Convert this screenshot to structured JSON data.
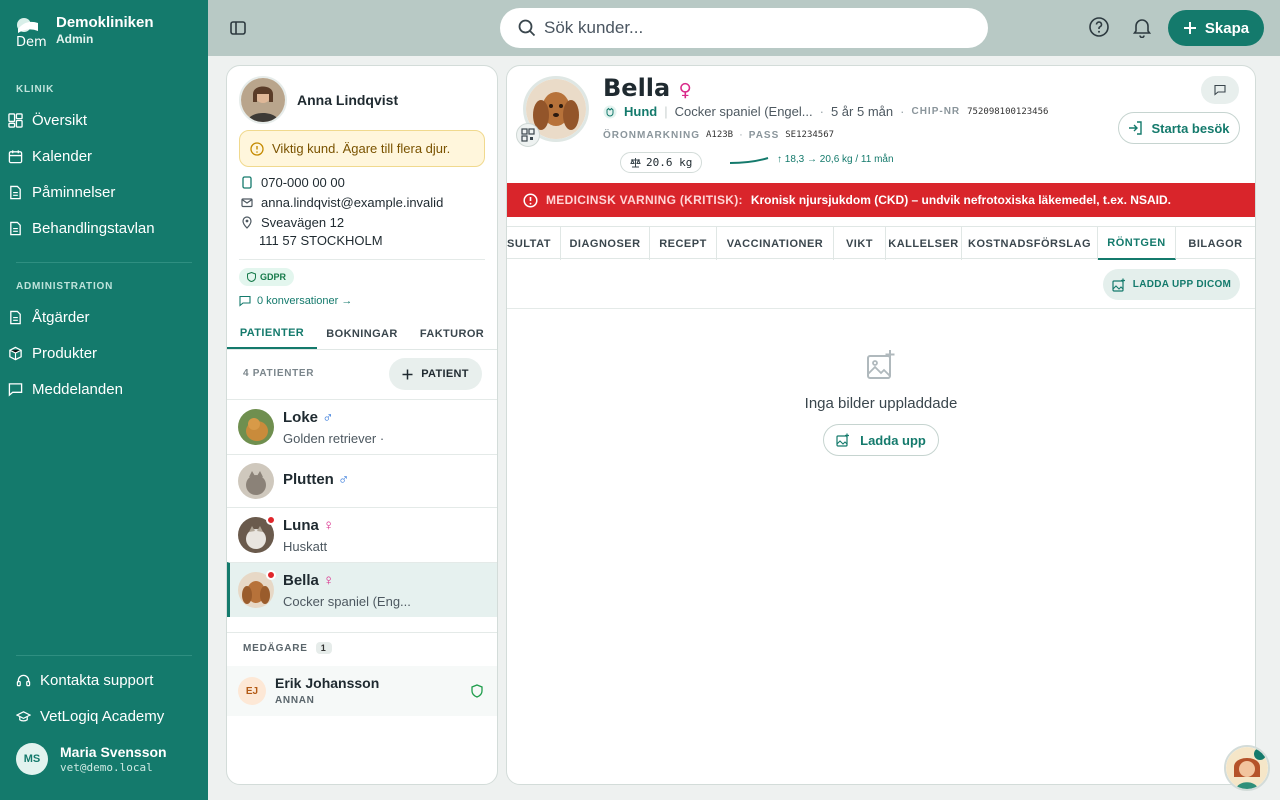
{
  "brand": {
    "title": "Demokliniken",
    "subtitle": "Admin",
    "logo_text": "Dem"
  },
  "sidebar": {
    "section_clinic": "KLINIK",
    "clinic_items": [
      {
        "label": "Översikt",
        "icon": "dashboard-icon"
      },
      {
        "label": "Kalender",
        "icon": "calendar-icon"
      },
      {
        "label": "Påminnelser",
        "icon": "document-icon"
      },
      {
        "label": "Behandlingstavlan",
        "icon": "document-icon"
      }
    ],
    "section_admin": "ADMINISTRATION",
    "admin_items": [
      {
        "label": "Åtgärder",
        "icon": "document-icon"
      },
      {
        "label": "Produkter",
        "icon": "box-icon"
      },
      {
        "label": "Meddelanden",
        "icon": "chat-icon"
      }
    ],
    "support": "Kontakta support",
    "academy": "VetLogiq Academy",
    "user": {
      "initials": "MS",
      "name": "Maria Svensson",
      "email": "vet@demo.local"
    }
  },
  "topbar": {
    "search_placeholder": "Sök kunder...",
    "create_label": "Skapa"
  },
  "owner": {
    "name": "Anna Lindqvist",
    "vip_note": "Viktig kund. Ägare till flera djur.",
    "phone": "070-000 00 00",
    "email": "anna.lindqvist@example.invalid",
    "street": "Sveavägen 12",
    "city": "111 57 STOCKHOLM",
    "gdpr_label": "GDPR",
    "conversations": "0 konversationer →",
    "tabs": [
      "PATIENTER",
      "BOKNINGAR",
      "FAKTUROR"
    ],
    "active_tab": "PATIENTER",
    "patient_count": "4 PATIENTER",
    "add_patient": "PATIENT",
    "patients": [
      {
        "name": "Loke",
        "sex": "♂",
        "breed": "Golden retriever ·",
        "alert": false
      },
      {
        "name": "Plutten",
        "sex": "♂",
        "breed": "",
        "alert": false
      },
      {
        "name": "Luna",
        "sex": "♀",
        "breed": "Huskatt",
        "alert": true
      },
      {
        "name": "Bella",
        "sex": "♀",
        "breed": "Cocker spaniel (Eng...",
        "alert": true
      }
    ],
    "coowners_label": "MEDÄGARE",
    "coowners_count": "1",
    "coowner": {
      "initials": "EJ",
      "name": "Erik Johansson",
      "role": "ANNAN"
    }
  },
  "patient": {
    "name": "Bella",
    "sex": "♀",
    "species": "Hund",
    "breed": "Cocker spaniel (Engel...",
    "age": "5 år 5 mån",
    "chip_label": "CHIP-NR",
    "chip": "752098100123456",
    "ear_label": "ÖRONMARKNING",
    "ear": "A123B",
    "pass_label": "PASS",
    "pass": "SE1234567",
    "weight": "20.6 kg",
    "trend": "↑ 18,3 → 20,6 kg / 11 mån",
    "start_visit": "Starta besök",
    "alert_label": "MEDICINSK VARNING (KRITISK):",
    "alert_text": "Kronisk njursjukdom (CKD) – undvik nefrotoxiska läkemedel, t.ex. NSAID.",
    "tabs": [
      "SULTAT",
      "DIAGNOSER",
      "RECEPT",
      "VACCINATIONER",
      "VIKT",
      "KALLELSER",
      "KOSTNADSFÖRSLAG",
      "RÖNTGEN",
      "BILAGOR"
    ],
    "active_tab": "RÖNTGEN",
    "upload_dicom": "LADDA UPP DICOM",
    "empty_text": "Inga bilder uppladdade",
    "upload": "Ladda upp"
  },
  "colors": {
    "brand": "#147a6c",
    "alert": "#d9252b",
    "female": "#d92a8a",
    "male": "#2a72d9"
  }
}
